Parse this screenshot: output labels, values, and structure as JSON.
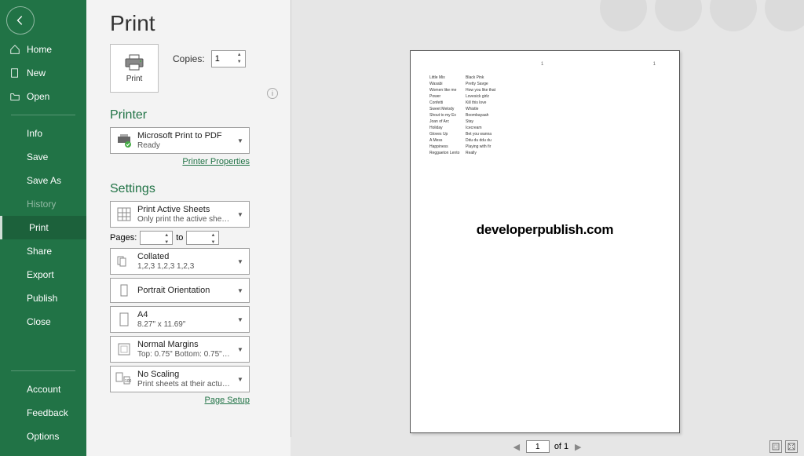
{
  "sidebar": {
    "items": [
      {
        "label": "Home",
        "icon": "home"
      },
      {
        "label": "New",
        "icon": "new"
      },
      {
        "label": "Open",
        "icon": "open"
      }
    ],
    "secondary": [
      {
        "label": "Info"
      },
      {
        "label": "Save"
      },
      {
        "label": "Save As"
      },
      {
        "label": "History",
        "disabled": true
      },
      {
        "label": "Print",
        "active": true
      },
      {
        "label": "Share"
      },
      {
        "label": "Export"
      },
      {
        "label": "Publish"
      },
      {
        "label": "Close"
      }
    ],
    "account": [
      {
        "label": "Account"
      },
      {
        "label": "Feedback"
      },
      {
        "label": "Options"
      }
    ]
  },
  "main": {
    "title": "Print",
    "print_tile": "Print",
    "copies_label": "Copies:",
    "copies_value": "1",
    "printer_heading": "Printer",
    "printer": {
      "name": "Microsoft Print to PDF",
      "status": "Ready"
    },
    "printer_props": "Printer Properties",
    "settings_heading": "Settings",
    "pages_label": "Pages:",
    "pages_to": "to",
    "page_setup": "Page Setup",
    "dropdowns": {
      "scope": {
        "line1": "Print Active Sheets",
        "line2": "Only print the active sheets"
      },
      "collate": {
        "line1": "Collated",
        "line2": "1,2,3   1,2,3   1,2,3"
      },
      "orient": {
        "line1": "Portrait Orientation",
        "line2": ""
      },
      "paper": {
        "line1": "A4",
        "line2": "8.27\" x 11.69\""
      },
      "margins": {
        "line1": "Normal Margins",
        "line2": "Top: 0.75\" Bottom: 0.75\" Lef…"
      },
      "scale": {
        "line1": "No Scaling",
        "line2": "Print sheets at their actual size"
      }
    }
  },
  "preview": {
    "page_left": "1",
    "page_right": "1",
    "watermark": "developerpublish.com",
    "current_page": "1",
    "of_label": "of 1",
    "data": [
      [
        "Little Mix",
        "Black Pink"
      ],
      [
        "Wasabi",
        "Pretty Savge"
      ],
      [
        "Women like me",
        "How you like that"
      ],
      [
        "Power",
        "Lovesick girlz"
      ],
      [
        "Confetti",
        "Kill this love"
      ],
      [
        "Sweet Melody",
        "Whistle"
      ],
      [
        "Shout to my Ex",
        "Boombayaah"
      ],
      [
        "Joan of Arc",
        "Stay"
      ],
      [
        "Holiday",
        "Icecream"
      ],
      [
        "Gloves Up",
        "Bet you wanna"
      ],
      [
        "A Mess",
        "Ddu du ddu du"
      ],
      [
        "Happiness",
        "Playing with fir"
      ],
      [
        "Reggaeton Lento",
        "Really"
      ]
    ]
  }
}
